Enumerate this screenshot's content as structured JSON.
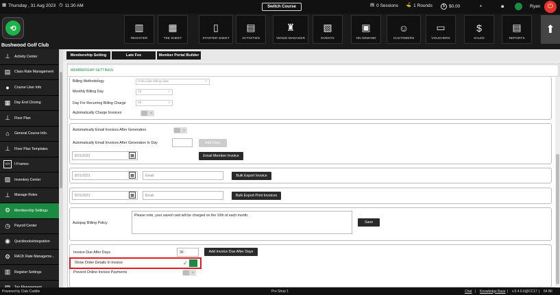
{
  "topbar": {
    "date": "Thursday , 31 Aug 2023",
    "time": "11:30 AM",
    "switch_course": "Switch Course",
    "sessions": "0 Sessions",
    "rounds": "1 Rounds",
    "amount": "$0.00",
    "user": "Ryan"
  },
  "club_name": "Bushwood Golf Club",
  "nav": [
    {
      "label": "REGISTER",
      "icon": "register-icon"
    },
    {
      "label": "TEE SHEET",
      "icon": "tee-sheet-icon"
    },
    {
      "label": "STARTER SHEET",
      "icon": "tablet-icon"
    },
    {
      "label": "ACTIVITIES",
      "icon": "calendar-icon"
    },
    {
      "label": "VENUE MANAGER",
      "icon": "venue-icon"
    },
    {
      "label": "EVENTS",
      "icon": "events-icon"
    },
    {
      "label": "ON DEMAND",
      "icon": "on-demand-icon"
    },
    {
      "label": "CUSTOMERS",
      "icon": "customers-icon"
    },
    {
      "label": "VOUCHERS",
      "icon": "vouchers-icon"
    },
    {
      "label": "SALES",
      "icon": "sales-icon"
    },
    {
      "label": "REPORTS",
      "icon": "reports-icon"
    }
  ],
  "sidebar": [
    {
      "label": "Activity Center",
      "icon": "org-chart-icon"
    },
    {
      "label": "Class Rate Management",
      "icon": "document-icon"
    },
    {
      "label": "Course User Info",
      "icon": "user-icon"
    },
    {
      "label": "Day End Closing",
      "icon": "calendar-icon"
    },
    {
      "label": "Floor Plan",
      "icon": "org-chart-icon"
    },
    {
      "label": "General Course Info.",
      "icon": "home-icon"
    },
    {
      "label": "Floor Plan Templates",
      "icon": "org-chart-icon"
    },
    {
      "label": "I-Frames",
      "icon": "code-icon"
    },
    {
      "label": "Inventory Center",
      "icon": "inventory-icon"
    },
    {
      "label": "Manage Roles",
      "icon": "org-chart-icon"
    },
    {
      "label": "Membership Settings",
      "icon": "gear-icon"
    },
    {
      "label": "Payroll Center",
      "icon": "clock-icon"
    },
    {
      "label": "QuickbooksIntegration",
      "icon": "quickbooks-icon"
    },
    {
      "label": "RACK Rate Manageme...",
      "icon": "rack-icon"
    },
    {
      "label": "Register Settings",
      "icon": "register-settings-icon"
    },
    {
      "label": "Tax Management",
      "icon": "tax-icon"
    }
  ],
  "tabs": [
    "Membership Setting",
    "Late Fee",
    "Member Portal Builder"
  ],
  "panel_title": "MEMBERSHIP SETTINGS",
  "form": {
    "billing_methodology_label": "Billing Methodology",
    "billing_methodology_value": "Club wide billing date",
    "monthly_billing_day_label": "Monthly Billing Day",
    "monthly_billing_day_value": "21",
    "recurring_billing_label": "Day For Recurring Billing Charge",
    "recurring_billing_value": "20",
    "auto_charge_label": "Automatically Charge Invoices",
    "auto_email_label": "Automatically Email Invoices After Generation",
    "auto_email_day_label": "Automatically Email Invoices After Generation In Day",
    "auto_email_day_value": "",
    "add_days_button": "Add Days",
    "date1": "8/31/2023",
    "email_member_invoice": "Email Member Invoice",
    "date2": "8/31/2023",
    "email_placeholder": "Email",
    "bulk_export_invoice": "Bulk Export Invoice",
    "date3": "8/31/2023",
    "email_placeholder2": "Email",
    "bulk_export_print": "Bulk Export Print Invoices",
    "autopay_label": "Autopay Billing Policy",
    "autopay_text": "Please note, your saved card will be charged on the 10th of each month.",
    "save_button": "Save",
    "invoice_due_label": "Invoice Due After Days",
    "invoice_due_value": "30",
    "add_invoice_due_button": "Add Invoice Due After Days",
    "show_order_label": "Show Order Details In Invoice",
    "prevent_online_label": "Prevent Online Invoice Payments",
    "toggle_x": "×",
    "check_glyph": "✓"
  },
  "footer": {
    "powered_by": "Powered by Club Caddie",
    "shop": "Pro Shop 1",
    "chat": "Chat",
    "kb": "Knowledge Base",
    "version": "v.5.4.6.6@CC17",
    "bits": "64 Bit"
  },
  "colors": {
    "accent": "#1d8a44",
    "highlight": "#e21b23",
    "dark": "#1a1a1a"
  }
}
